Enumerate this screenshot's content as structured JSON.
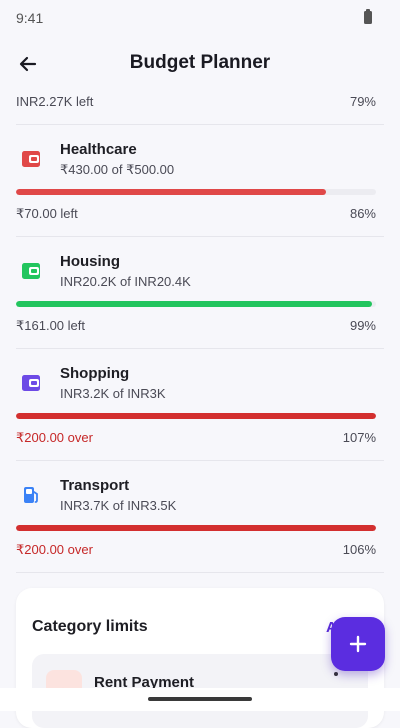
{
  "status_bar": {
    "time": "9:41"
  },
  "app_bar": {
    "title": "Budget Planner",
    "back_icon": "arrow-left-icon"
  },
  "previous_row": {
    "left_text": "INR2.27K left",
    "percent": "79%"
  },
  "categories": [
    {
      "name": "Healthcare",
      "amount": "₹430.00 of ₹500.00",
      "icon": "wallet-icon",
      "color": "#E04848",
      "progress": 0.86,
      "status": "₹70.00 left",
      "percent": "86%",
      "over": false
    },
    {
      "name": "Housing",
      "amount": "INR20.2K of INR20.4K",
      "icon": "wallet-icon",
      "color": "#22C55E",
      "progress": 0.99,
      "status": "₹161.00 left",
      "percent": "99%",
      "over": false
    },
    {
      "name": "Shopping",
      "amount": "INR3.2K of INR3K",
      "icon": "wallet-icon",
      "color": "#6D4AE6",
      "progress": 1.0,
      "bar_color": "#D32F2F",
      "status": "₹200.00 over",
      "percent": "107%",
      "over": true
    },
    {
      "name": "Transport",
      "amount": "INR3.7K of INR3.5K",
      "icon": "fuel-pump-icon",
      "color": "#3B82F6",
      "progress": 1.0,
      "bar_color": "#D32F2F",
      "status": "₹200.00 over",
      "percent": "106%",
      "over": true
    }
  ],
  "limits_card": {
    "title": "Category limits",
    "action_label": "A",
    "item": {
      "title": "Rent Payment",
      "icon": "home-icon"
    }
  },
  "fab": {
    "icon": "plus-icon"
  }
}
